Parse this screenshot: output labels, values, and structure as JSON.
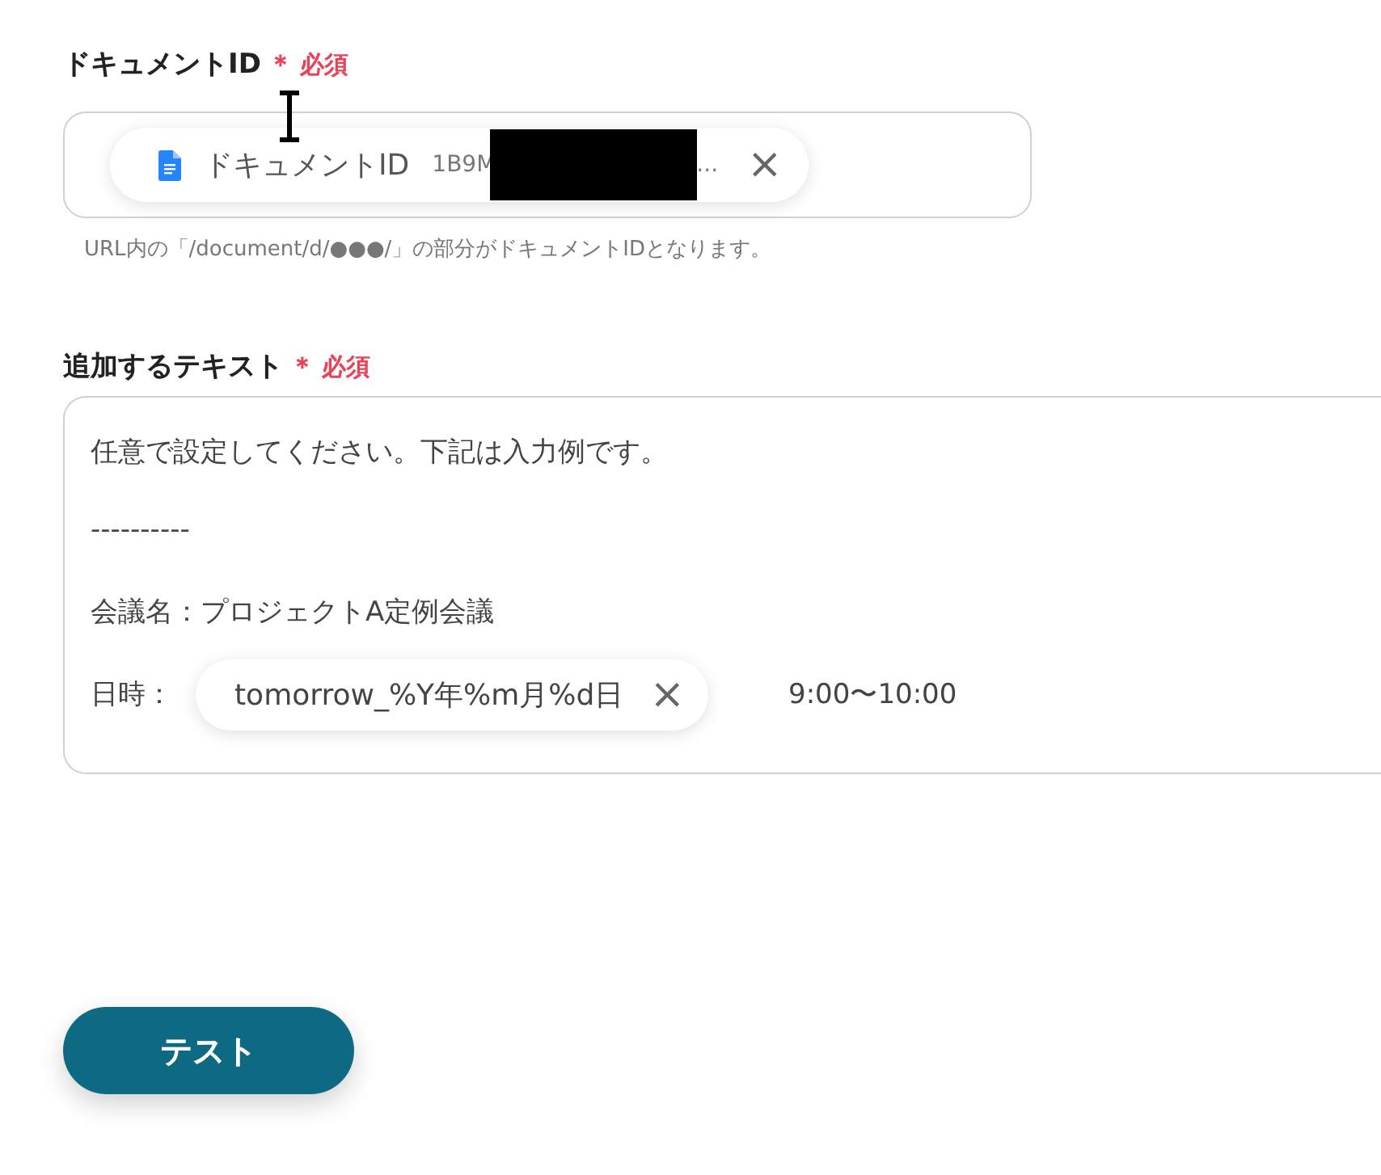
{
  "fields": [
    {
      "label": "ドキュメントID",
      "required_mark": "＊",
      "required_text": "必須",
      "kind": "chip_input",
      "chip": {
        "label": "ドキュメントID",
        "value": "1B9M",
        "ellipsis": "...",
        "redacted": true,
        "close": "×"
      },
      "hint": "URL内の「/document/d/●●●/」の部分がドキュメントIDとなります。"
    },
    {
      "label": "追加するテキスト",
      "required_mark": "＊",
      "required_text": "必須",
      "kind": "textarea",
      "lines": [
        {
          "parts": [
            {
              "kind": "text",
              "text": "任意で設定してください。下記は入力例です。"
            }
          ]
        },
        {
          "parts": [
            {
              "kind": "text",
              "text": "----------"
            }
          ]
        },
        {
          "parts": [
            {
              "kind": "text",
              "text": "会議名：プロジェクトA定例会議"
            }
          ]
        },
        {
          "parts": [
            {
              "kind": "text",
              "text": "日時："
            },
            {
              "kind": "chip",
              "text": "tomorrow_%Y年%m月%d日",
              "close": "×"
            },
            {
              "kind": "text",
              "text": "9:00〜10:00"
            }
          ]
        }
      ]
    }
  ],
  "button": {
    "label": "テスト"
  }
}
